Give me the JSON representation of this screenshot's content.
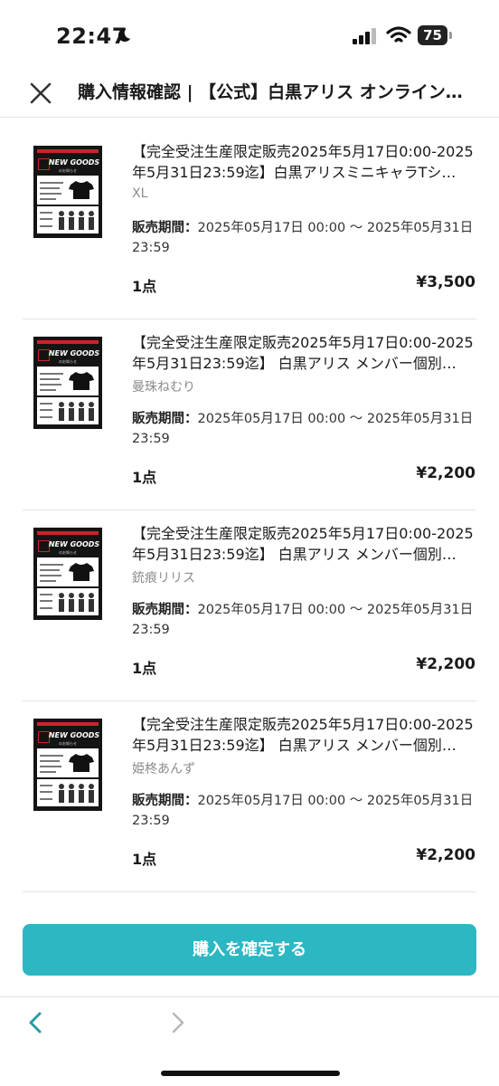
{
  "status_bar": {
    "time": "22:47",
    "battery": "75"
  },
  "header": {
    "title": "購入情報確認 | 【公式】白黒アリス オンライン…"
  },
  "items": [
    {
      "name": "【完全受注生産限定販売2025年5月17日0:00-2025年5月31日23:59迄】白黒アリスミニキャラTシ…",
      "variant": "XL",
      "period_label": "販売期間：",
      "period_value": "2025年05月17日 00:00 〜 2025年05月31日 23:59",
      "qty": "1点",
      "price": "¥3,500"
    },
    {
      "name": "【完全受注生産限定販売2025年5月17日0:00-2025年5月31日23:59迄】 白黒アリス メンバー個別…",
      "variant": "曼珠ねむり",
      "period_label": "販売期間：",
      "period_value": "2025年05月17日 00:00 〜 2025年05月31日 23:59",
      "qty": "1点",
      "price": "¥2,200"
    },
    {
      "name": "【完全受注生産限定販売2025年5月17日0:00-2025年5月31日23:59迄】 白黒アリス メンバー個別…",
      "variant": "銃痕リリス",
      "period_label": "販売期間：",
      "period_value": "2025年05月17日 00:00 〜 2025年05月31日 23:59",
      "qty": "1点",
      "price": "¥2,200"
    },
    {
      "name": "【完全受注生産限定販売2025年5月17日0:00-2025年5月31日23:59迄】 白黒アリス メンバー個別…",
      "variant": "姫柊あんず",
      "period_label": "販売期間：",
      "period_value": "2025年05月17日 00:00 〜 2025年05月31日 23:59",
      "qty": "1点",
      "price": "¥2,200"
    }
  ],
  "thumbnail": {
    "heading": "NEW GOODS",
    "subheading": "のお知らせ"
  },
  "confirm_button": {
    "label": "購入を確定する"
  },
  "colors": {
    "accent": "#2db7c2",
    "brand_red": "#c8252a"
  },
  "icons": {
    "close": "close-icon",
    "back": "chevron-left-icon",
    "forward": "chevron-right-icon"
  }
}
